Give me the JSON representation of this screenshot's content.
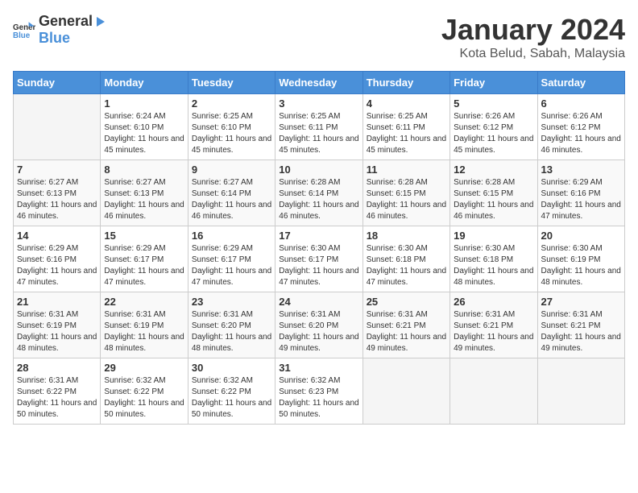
{
  "logo": {
    "general": "General",
    "blue": "Blue"
  },
  "header": {
    "month": "January 2024",
    "location": "Kota Belud, Sabah, Malaysia"
  },
  "weekdays": [
    "Sunday",
    "Monday",
    "Tuesday",
    "Wednesday",
    "Thursday",
    "Friday",
    "Saturday"
  ],
  "weeks": [
    [
      {
        "day": "",
        "sunrise": "",
        "sunset": "",
        "daylight": ""
      },
      {
        "day": "1",
        "sunrise": "Sunrise: 6:24 AM",
        "sunset": "Sunset: 6:10 PM",
        "daylight": "Daylight: 11 hours and 45 minutes."
      },
      {
        "day": "2",
        "sunrise": "Sunrise: 6:25 AM",
        "sunset": "Sunset: 6:10 PM",
        "daylight": "Daylight: 11 hours and 45 minutes."
      },
      {
        "day": "3",
        "sunrise": "Sunrise: 6:25 AM",
        "sunset": "Sunset: 6:11 PM",
        "daylight": "Daylight: 11 hours and 45 minutes."
      },
      {
        "day": "4",
        "sunrise": "Sunrise: 6:25 AM",
        "sunset": "Sunset: 6:11 PM",
        "daylight": "Daylight: 11 hours and 45 minutes."
      },
      {
        "day": "5",
        "sunrise": "Sunrise: 6:26 AM",
        "sunset": "Sunset: 6:12 PM",
        "daylight": "Daylight: 11 hours and 45 minutes."
      },
      {
        "day": "6",
        "sunrise": "Sunrise: 6:26 AM",
        "sunset": "Sunset: 6:12 PM",
        "daylight": "Daylight: 11 hours and 46 minutes."
      }
    ],
    [
      {
        "day": "7",
        "sunrise": "Sunrise: 6:27 AM",
        "sunset": "Sunset: 6:13 PM",
        "daylight": "Daylight: 11 hours and 46 minutes."
      },
      {
        "day": "8",
        "sunrise": "Sunrise: 6:27 AM",
        "sunset": "Sunset: 6:13 PM",
        "daylight": "Daylight: 11 hours and 46 minutes."
      },
      {
        "day": "9",
        "sunrise": "Sunrise: 6:27 AM",
        "sunset": "Sunset: 6:14 PM",
        "daylight": "Daylight: 11 hours and 46 minutes."
      },
      {
        "day": "10",
        "sunrise": "Sunrise: 6:28 AM",
        "sunset": "Sunset: 6:14 PM",
        "daylight": "Daylight: 11 hours and 46 minutes."
      },
      {
        "day": "11",
        "sunrise": "Sunrise: 6:28 AM",
        "sunset": "Sunset: 6:15 PM",
        "daylight": "Daylight: 11 hours and 46 minutes."
      },
      {
        "day": "12",
        "sunrise": "Sunrise: 6:28 AM",
        "sunset": "Sunset: 6:15 PM",
        "daylight": "Daylight: 11 hours and 46 minutes."
      },
      {
        "day": "13",
        "sunrise": "Sunrise: 6:29 AM",
        "sunset": "Sunset: 6:16 PM",
        "daylight": "Daylight: 11 hours and 47 minutes."
      }
    ],
    [
      {
        "day": "14",
        "sunrise": "Sunrise: 6:29 AM",
        "sunset": "Sunset: 6:16 PM",
        "daylight": "Daylight: 11 hours and 47 minutes."
      },
      {
        "day": "15",
        "sunrise": "Sunrise: 6:29 AM",
        "sunset": "Sunset: 6:17 PM",
        "daylight": "Daylight: 11 hours and 47 minutes."
      },
      {
        "day": "16",
        "sunrise": "Sunrise: 6:29 AM",
        "sunset": "Sunset: 6:17 PM",
        "daylight": "Daylight: 11 hours and 47 minutes."
      },
      {
        "day": "17",
        "sunrise": "Sunrise: 6:30 AM",
        "sunset": "Sunset: 6:17 PM",
        "daylight": "Daylight: 11 hours and 47 minutes."
      },
      {
        "day": "18",
        "sunrise": "Sunrise: 6:30 AM",
        "sunset": "Sunset: 6:18 PM",
        "daylight": "Daylight: 11 hours and 47 minutes."
      },
      {
        "day": "19",
        "sunrise": "Sunrise: 6:30 AM",
        "sunset": "Sunset: 6:18 PM",
        "daylight": "Daylight: 11 hours and 48 minutes."
      },
      {
        "day": "20",
        "sunrise": "Sunrise: 6:30 AM",
        "sunset": "Sunset: 6:19 PM",
        "daylight": "Daylight: 11 hours and 48 minutes."
      }
    ],
    [
      {
        "day": "21",
        "sunrise": "Sunrise: 6:31 AM",
        "sunset": "Sunset: 6:19 PM",
        "daylight": "Daylight: 11 hours and 48 minutes."
      },
      {
        "day": "22",
        "sunrise": "Sunrise: 6:31 AM",
        "sunset": "Sunset: 6:19 PM",
        "daylight": "Daylight: 11 hours and 48 minutes."
      },
      {
        "day": "23",
        "sunrise": "Sunrise: 6:31 AM",
        "sunset": "Sunset: 6:20 PM",
        "daylight": "Daylight: 11 hours and 48 minutes."
      },
      {
        "day": "24",
        "sunrise": "Sunrise: 6:31 AM",
        "sunset": "Sunset: 6:20 PM",
        "daylight": "Daylight: 11 hours and 49 minutes."
      },
      {
        "day": "25",
        "sunrise": "Sunrise: 6:31 AM",
        "sunset": "Sunset: 6:21 PM",
        "daylight": "Daylight: 11 hours and 49 minutes."
      },
      {
        "day": "26",
        "sunrise": "Sunrise: 6:31 AM",
        "sunset": "Sunset: 6:21 PM",
        "daylight": "Daylight: 11 hours and 49 minutes."
      },
      {
        "day": "27",
        "sunrise": "Sunrise: 6:31 AM",
        "sunset": "Sunset: 6:21 PM",
        "daylight": "Daylight: 11 hours and 49 minutes."
      }
    ],
    [
      {
        "day": "28",
        "sunrise": "Sunrise: 6:31 AM",
        "sunset": "Sunset: 6:22 PM",
        "daylight": "Daylight: 11 hours and 50 minutes."
      },
      {
        "day": "29",
        "sunrise": "Sunrise: 6:32 AM",
        "sunset": "Sunset: 6:22 PM",
        "daylight": "Daylight: 11 hours and 50 minutes."
      },
      {
        "day": "30",
        "sunrise": "Sunrise: 6:32 AM",
        "sunset": "Sunset: 6:22 PM",
        "daylight": "Daylight: 11 hours and 50 minutes."
      },
      {
        "day": "31",
        "sunrise": "Sunrise: 6:32 AM",
        "sunset": "Sunset: 6:23 PM",
        "daylight": "Daylight: 11 hours and 50 minutes."
      },
      {
        "day": "",
        "sunrise": "",
        "sunset": "",
        "daylight": ""
      },
      {
        "day": "",
        "sunrise": "",
        "sunset": "",
        "daylight": ""
      },
      {
        "day": "",
        "sunrise": "",
        "sunset": "",
        "daylight": ""
      }
    ]
  ]
}
